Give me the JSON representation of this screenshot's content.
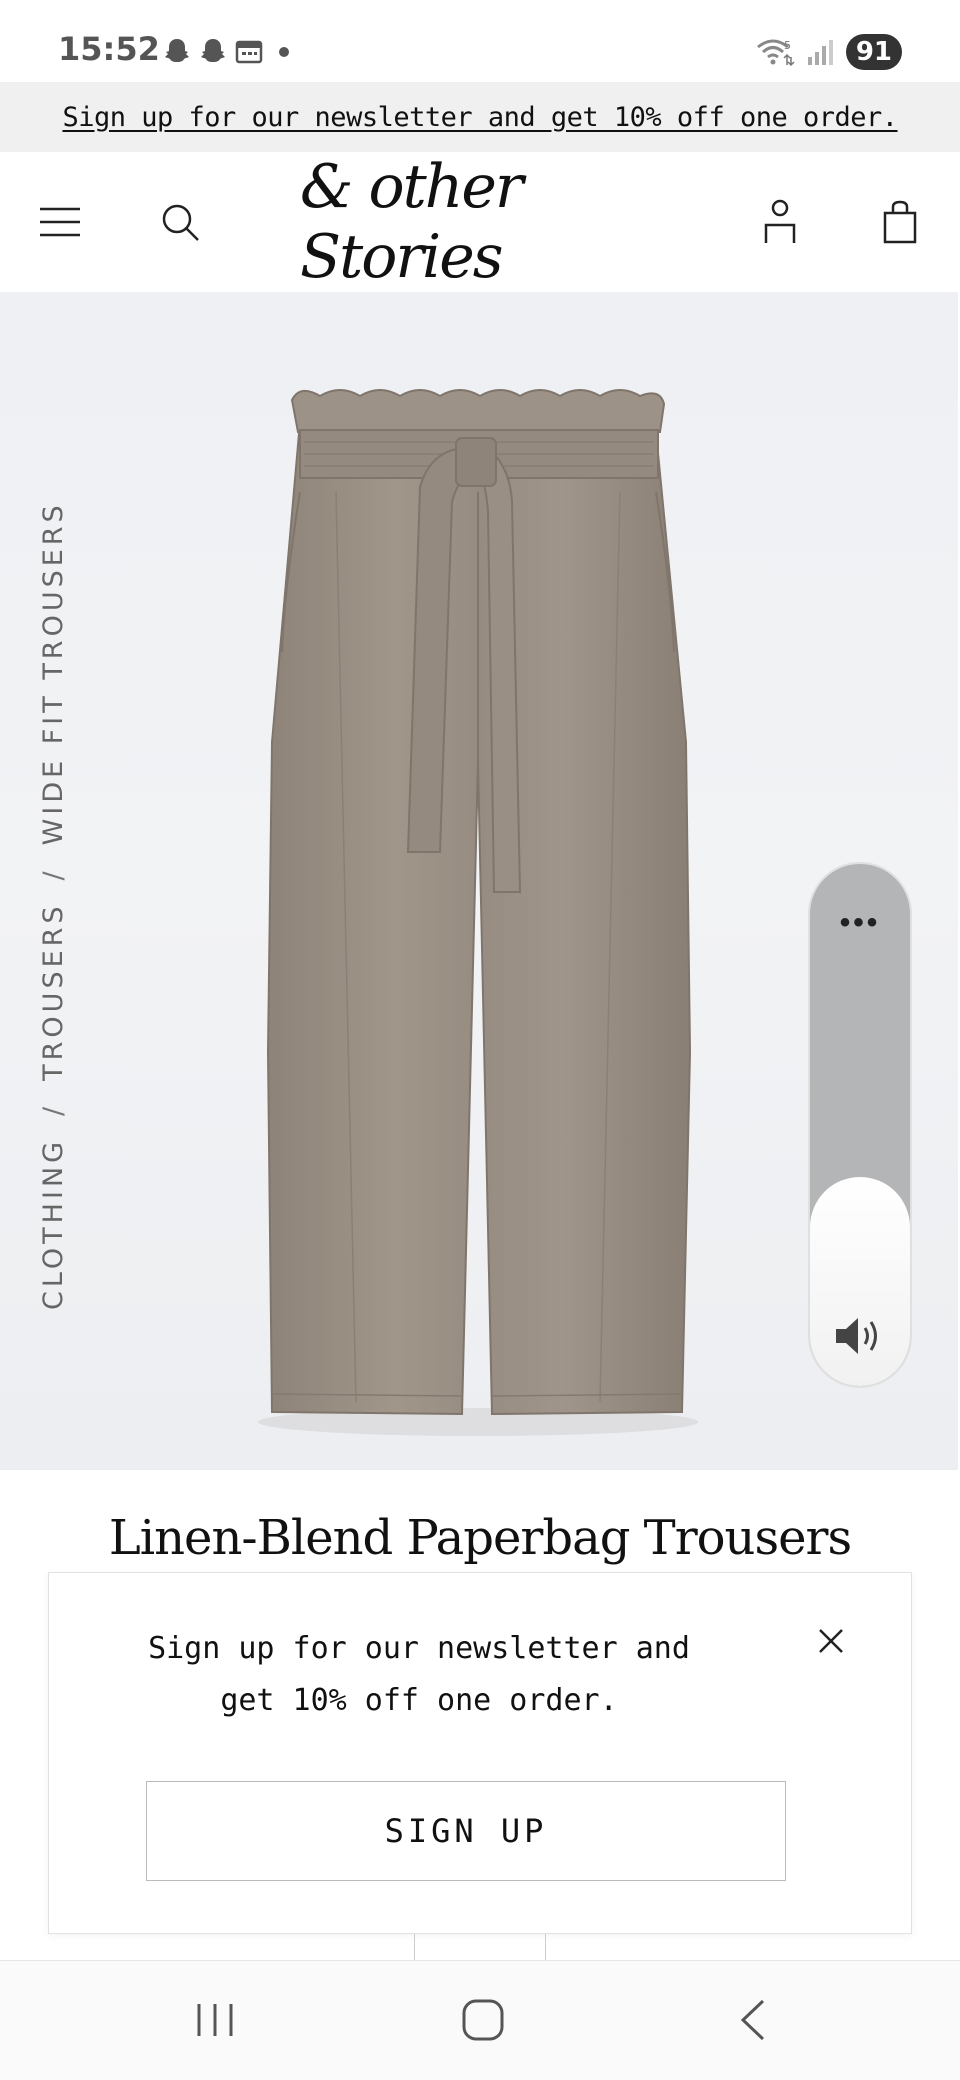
{
  "status_bar": {
    "time": "15:52",
    "left_icons": [
      "snapchat-icon",
      "snapchat-icon",
      "calendar-icon",
      "dot-icon"
    ],
    "right_icons": [
      "wifi-icon",
      "signal-icon"
    ],
    "battery": "91"
  },
  "banner": {
    "text": "Sign up for our newsletter and get 10% off one order."
  },
  "header": {
    "logo": "& other Stories",
    "icons": [
      "menu-icon",
      "search-icon",
      "account-icon",
      "bag-icon"
    ]
  },
  "breadcrumb": {
    "items": [
      "CLOTHING",
      "TROUSERS",
      "WIDE FIT TROUSERS"
    ],
    "separator": "/"
  },
  "volume_overlay": {
    "menu_label": "•••",
    "level": 0.4
  },
  "product": {
    "title": "Linen-Blend Paperbag Trousers",
    "color": "#9a8f84"
  },
  "popup": {
    "text": "Sign up for our newsletter and get 10% off one order.",
    "button": "SIGN UP"
  },
  "navbar": {
    "icons": [
      "recent-apps-icon",
      "home-icon",
      "back-icon"
    ]
  }
}
